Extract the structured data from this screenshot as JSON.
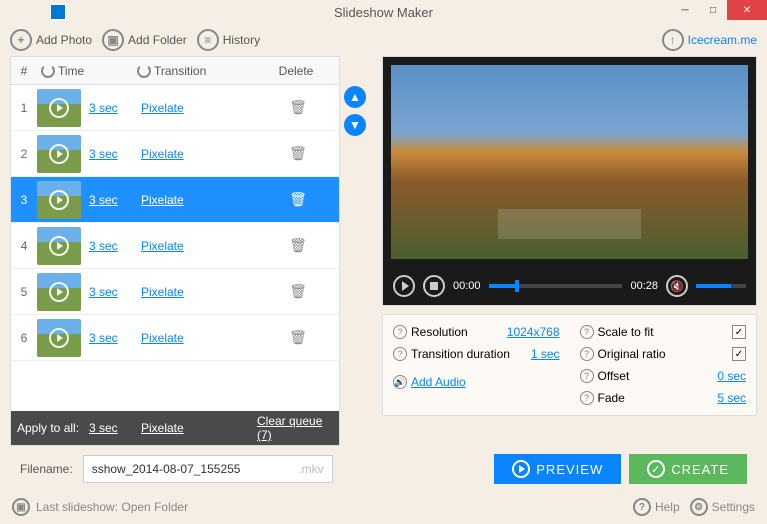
{
  "window": {
    "title": "Slideshow Maker"
  },
  "toolbar": {
    "add_photo": "Add Photo",
    "add_folder": "Add Folder",
    "history": "History",
    "icecream": "Icecream.me"
  },
  "table": {
    "headers": {
      "num": "#",
      "time": "Time",
      "transition": "Transition",
      "delete": "Delete"
    },
    "rows": [
      {
        "n": "1",
        "time": "3 sec",
        "trans": "Pixelate",
        "selected": false
      },
      {
        "n": "2",
        "time": "3 sec",
        "trans": "Pixelate",
        "selected": false
      },
      {
        "n": "3",
        "time": "3 sec",
        "trans": "Pixelate",
        "selected": true
      },
      {
        "n": "4",
        "time": "3 sec",
        "trans": "Pixelate",
        "selected": false
      },
      {
        "n": "5",
        "time": "3 sec",
        "trans": "Pixelate",
        "selected": false
      },
      {
        "n": "6",
        "time": "3 sec",
        "trans": "Pixelate",
        "selected": false
      }
    ],
    "apply": {
      "label": "Apply to all:",
      "time": "3 sec",
      "trans": "Pixelate",
      "clear": "Clear queue (7)"
    }
  },
  "player": {
    "current": "00:00",
    "total": "00:28"
  },
  "settings": {
    "resolution_label": "Resolution",
    "resolution_val": "1024x768",
    "trans_dur_label": "Transition duration",
    "trans_dur_val": "1 sec",
    "add_audio": "Add Audio",
    "scale_label": "Scale to fit",
    "ratio_label": "Original ratio",
    "offset_label": "Offset",
    "offset_val": "0 sec",
    "fade_label": "Fade",
    "fade_val": "5 sec"
  },
  "filename": {
    "label": "Filename:",
    "value": "sshow_2014-08-07_155255",
    "ext": ".mkv"
  },
  "buttons": {
    "preview": "PREVIEW",
    "create": "CREATE"
  },
  "footer": {
    "last": "Last slideshow: Open Folder",
    "help": "Help",
    "settings": "Settings"
  }
}
